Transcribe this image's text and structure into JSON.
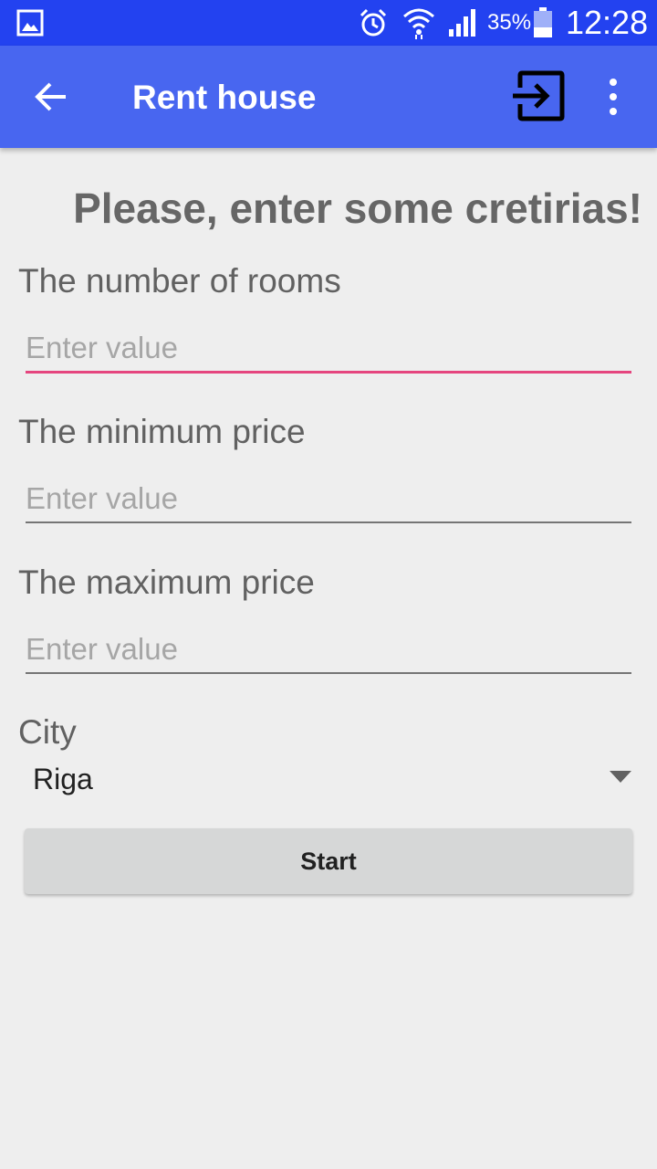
{
  "status_bar": {
    "battery_percent": "35%",
    "time": "12:28",
    "icons": [
      "gallery-icon",
      "alarm-icon",
      "wifi-icon",
      "signal-icon",
      "battery-icon"
    ]
  },
  "app_bar": {
    "title": "Rent house",
    "back_icon": "arrow-left-icon",
    "exit_icon": "exit-to-app-icon",
    "more_icon": "more-vert-icon",
    "color": "#4866f0"
  },
  "form": {
    "heading": "Please, enter some cretirias!",
    "rooms": {
      "label": "The number of rooms",
      "placeholder": "Enter value",
      "value": ""
    },
    "min_price": {
      "label": "The minimum price",
      "placeholder": "Enter value",
      "value": ""
    },
    "max_price": {
      "label": "The maximum price",
      "placeholder": "Enter value",
      "value": ""
    },
    "city": {
      "label": "City",
      "selected": "Riga"
    },
    "start_label": "Start"
  },
  "colors": {
    "status_bar": "#2342f0",
    "app_bar": "#4866f0",
    "focus_underline": "#e5457e",
    "background": "#eeeeee",
    "button": "#d6d7d7"
  }
}
